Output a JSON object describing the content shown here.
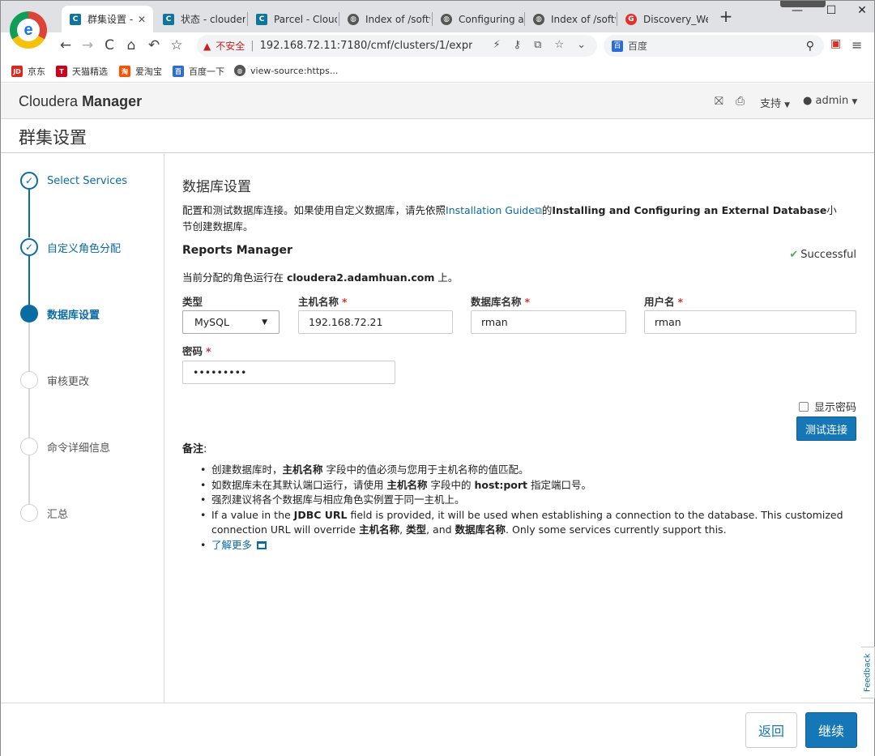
{
  "browser": {
    "tabs": [
      {
        "label": "群集设置 -",
        "icon": "cloudera-favicon-icon",
        "active": true
      },
      {
        "label": "状态 - clouder",
        "icon": "cloudera-favicon-icon"
      },
      {
        "label": "Parcel - Cloud",
        "icon": "cloudera-favicon-icon"
      },
      {
        "label": "Index of /softw",
        "icon": "globe-icon"
      },
      {
        "label": "Configuring a",
        "icon": "globe-icon"
      },
      {
        "label": "Index of /softw",
        "icon": "globe-icon"
      },
      {
        "label": "Discovery_We",
        "icon": "discovery-favicon-icon"
      }
    ],
    "new_tab": "+",
    "window_controls": {
      "minimize": "—",
      "maximize": "☐",
      "close": "✕"
    },
    "nav": {
      "back": "←",
      "forward": "→",
      "reload": "C",
      "home": "⌂",
      "undo": "↶",
      "star": "☆"
    },
    "address": {
      "security_label": "不安全",
      "separator": "|",
      "url": "192.168.72.11:7180/cmf/clusters/1/expre..."
    },
    "search_box": {
      "placeholder": "百度",
      "engine_icon": "baidu-paw-icon"
    },
    "bookmarks": [
      {
        "label": "京东",
        "icon": "jd-icon",
        "icon_text": "JD",
        "color": "#e1251b"
      },
      {
        "label": "天猫精选",
        "icon": "tmall-icon",
        "icon_text": "T",
        "color": "#d4001a"
      },
      {
        "label": "爱淘宝",
        "icon": "taobao-icon",
        "icon_text": "淘",
        "color": "#ff5000"
      },
      {
        "label": "百度一下",
        "icon": "baidu-paw-icon",
        "icon_text": "百",
        "color": "#2d6bd7"
      },
      {
        "label": "view-source:https...",
        "icon": "globe-icon",
        "icon_text": "",
        "color": "#555555"
      }
    ]
  },
  "app": {
    "brand_light": "Cloudera",
    "brand_bold": "Manager",
    "support_label": "支持",
    "user_label": "admin"
  },
  "page": {
    "title": "群集设置"
  },
  "wizard": {
    "steps": [
      {
        "label": "Select Services",
        "state": "done"
      },
      {
        "label": "自定义角色分配",
        "state": "done"
      },
      {
        "label": "数据库设置",
        "state": "current"
      },
      {
        "label": "审核更改",
        "state": "todo"
      },
      {
        "label": "命令详细信息",
        "state": "todo"
      },
      {
        "label": "汇总",
        "state": "todo"
      }
    ]
  },
  "section": {
    "heading": "数据库设置",
    "desc_prefix": "配置和测试数据库连接。如果使用自定义数据库，请先依照",
    "desc_link": "Installation Guide",
    "desc_mid": "的",
    "desc_bold": "Installing and Configuring an External Database",
    "desc_suffix": "小节创建数据库。"
  },
  "reports_manager": {
    "title": "Reports Manager",
    "status": "Successful",
    "assigned_prefix": "当前分配的角色运行在 ",
    "assigned_host": "cloudera2.adamhuan.com",
    "assigned_suffix": " 上。",
    "fields": {
      "type_label": "类型",
      "type_value": "MySQL",
      "host_label": "主机名称",
      "host_value": "192.168.72.21",
      "dbname_label": "数据库名称",
      "dbname_value": "rman",
      "user_label": "用户名",
      "user_value": "rman",
      "password_label": "密码",
      "password_value": "•••••••••",
      "required_marker": "*"
    },
    "show_password_label": "显示密码",
    "test_button": "测试连接"
  },
  "notes": {
    "title": "备注",
    "title_colon": ":",
    "item1_a": "创建数据库时，",
    "item1_b": "主机名称",
    "item1_c": " 字段中的值必须与您用于主机名称的值匹配。",
    "item2_a": "如数据库未在其默认端口运行，请使用 ",
    "item2_b": "主机名称",
    "item2_c": " 字段中的 ",
    "item2_d": "host:port",
    "item2_e": " 指定端口号。",
    "item3": "强烈建议将各个数据库与相应角色实例置于同一主机上。",
    "item4_a": "If a value in the ",
    "item4_b": "JDBC URL",
    "item4_c": " field is provided, it will be used when establishing a connection to the database. This customized connection URL will override ",
    "item4_d": "主机名称",
    "item4_e": ", ",
    "item4_f": "类型",
    "item4_g": ", and ",
    "item4_h": "数据库名称",
    "item4_i": ". Only some services currently support this.",
    "learn_more": "了解更多"
  },
  "feedback_label": "Feedback",
  "footer": {
    "back": "返回",
    "next": "继续"
  },
  "colors": {
    "accent": "#1677b8",
    "link": "#0b6ba3",
    "success": "#4caf50",
    "required": "#cc3333"
  }
}
